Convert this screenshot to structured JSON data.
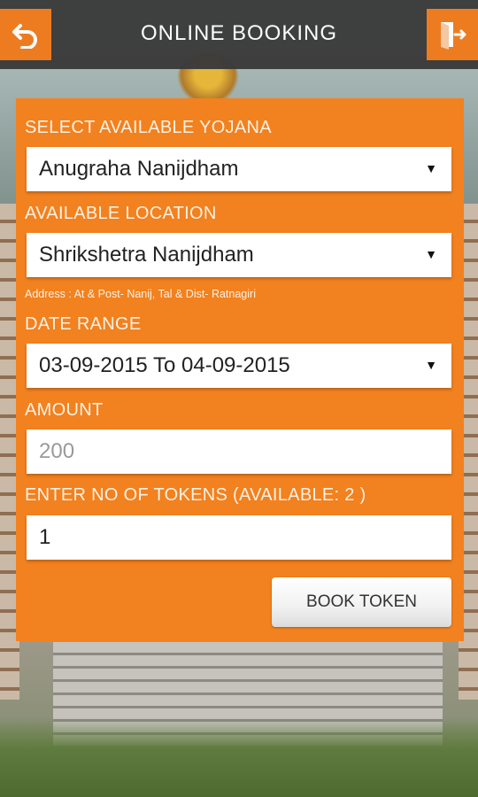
{
  "header": {
    "title": "ONLINE BOOKING",
    "back_icon": "back-arrow-icon",
    "exit_icon": "logout-icon"
  },
  "form": {
    "yojana": {
      "label": "SELECT AVAILABLE YOJANA",
      "value": "Anugraha Nanijdham"
    },
    "location": {
      "label": "AVAILABLE LOCATION",
      "value": "Shrikshetra Nanijdham"
    },
    "address": "Address : At & Post- Nanij, Tal & Dist- Ratnagiri",
    "date_range": {
      "label": "DATE RANGE",
      "value": "03-09-2015 To 04-09-2015"
    },
    "amount": {
      "label": "AMOUNT",
      "value": "200"
    },
    "tokens": {
      "label": "ENTER NO OF TOKENS  (AVAILABLE: 2 )",
      "value": "1"
    },
    "submit_label": "BOOK TOKEN"
  },
  "colors": {
    "accent": "#f2811f",
    "header_bg": "#3a3a3a"
  }
}
